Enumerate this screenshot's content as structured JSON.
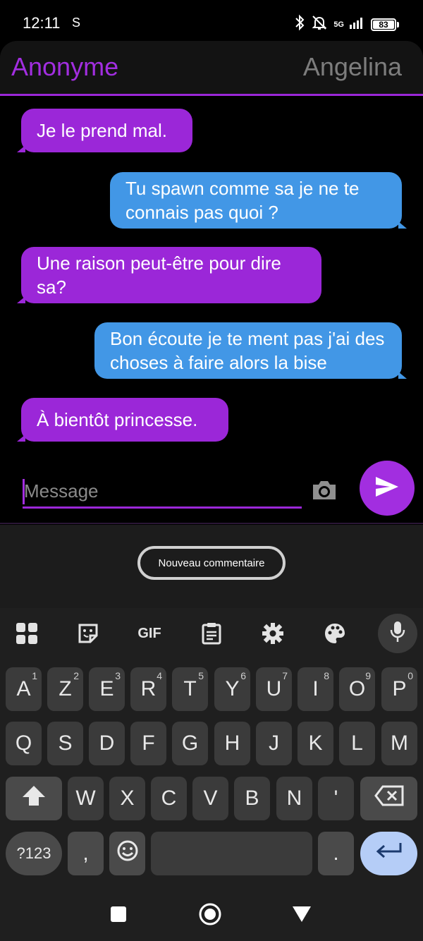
{
  "status_bar": {
    "time": "12:11",
    "s_label": "S",
    "network": "5G",
    "battery": "83"
  },
  "header": {
    "left_name": "Anonyme",
    "right_name": "Angelina"
  },
  "messages": [
    {
      "text": "Je le prend mal.",
      "side": "left"
    },
    {
      "text": "Tu spawn comme sa je ne te connais pas quoi ?",
      "side": "right"
    },
    {
      "text": "Une raison peut-être pour dire sa?",
      "side": "left"
    },
    {
      "text": "Bon écoute je te ment pas j'ai des choses à faire alors la bise",
      "side": "right"
    },
    {
      "text": "À bientôt princesse.",
      "side": "left"
    }
  ],
  "input": {
    "placeholder": "Message",
    "value": ""
  },
  "comment_button": "Nouveau commentaire",
  "keyboard": {
    "toolbar": {
      "gif_label": "GIF"
    },
    "row1": [
      {
        "k": "A",
        "n": "1"
      },
      {
        "k": "Z",
        "n": "2"
      },
      {
        "k": "E",
        "n": "3"
      },
      {
        "k": "R",
        "n": "4"
      },
      {
        "k": "T",
        "n": "5"
      },
      {
        "k": "Y",
        "n": "6"
      },
      {
        "k": "U",
        "n": "7"
      },
      {
        "k": "I",
        "n": "8"
      },
      {
        "k": "O",
        "n": "9"
      },
      {
        "k": "P",
        "n": "0"
      }
    ],
    "row2": [
      "Q",
      "S",
      "D",
      "F",
      "G",
      "H",
      "J",
      "K",
      "L",
      "M"
    ],
    "row3": [
      "W",
      "X",
      "C",
      "V",
      "B",
      "N",
      "'"
    ],
    "row4": {
      "symbols": "?123",
      "comma": ",",
      "period": "."
    }
  },
  "colors": {
    "accent": "#9b27d8",
    "blue_bubble": "#4297e6",
    "enter_key": "#b5cdf7"
  }
}
